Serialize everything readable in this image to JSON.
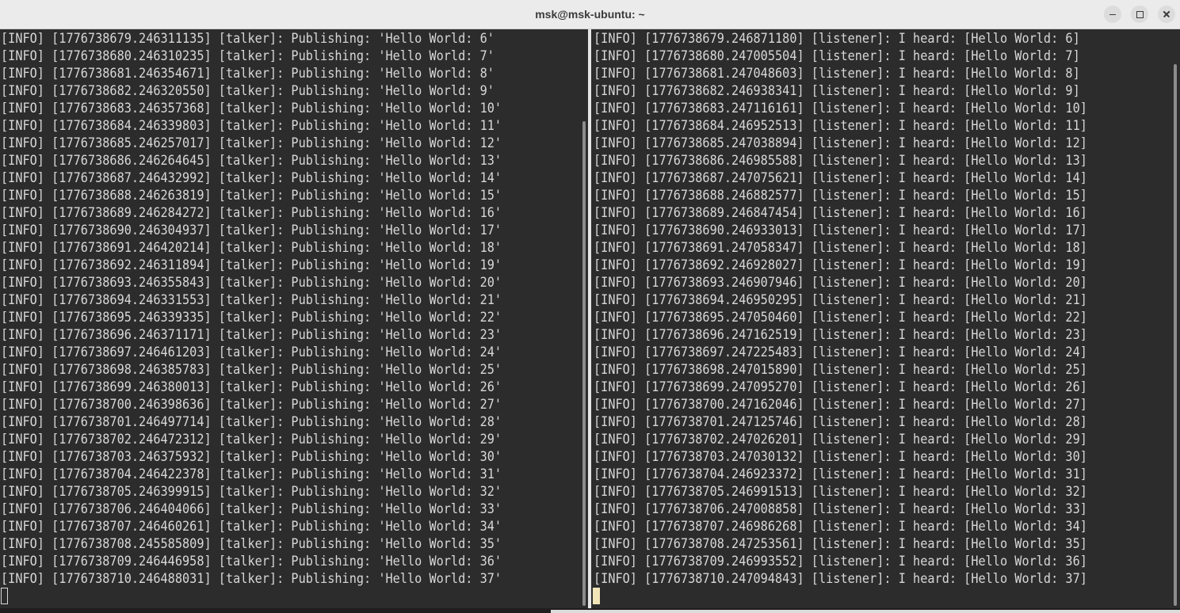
{
  "window": {
    "title": "msk@msk-ubuntu: ~",
    "buttons": {
      "minimize_icon": "minimize-icon",
      "maximize_icon": "maximize-icon",
      "close_icon": "close-icon"
    }
  },
  "colors": {
    "terminal_background": "#2c2c2c",
    "terminal_text": "#d8d8d8",
    "titlebar_background": "#ebebeb",
    "active_cursor": "#f2e6b8"
  },
  "left_pane": {
    "lines": [
      "[INFO] [1776738679.246311135] [talker]: Publishing: 'Hello World: 6'",
      "[INFO] [1776738680.246310235] [talker]: Publishing: 'Hello World: 7'",
      "[INFO] [1776738681.246354671] [talker]: Publishing: 'Hello World: 8'",
      "[INFO] [1776738682.246320550] [talker]: Publishing: 'Hello World: 9'",
      "[INFO] [1776738683.246357368] [talker]: Publishing: 'Hello World: 10'",
      "[INFO] [1776738684.246339803] [talker]: Publishing: 'Hello World: 11'",
      "[INFO] [1776738685.246257017] [talker]: Publishing: 'Hello World: 12'",
      "[INFO] [1776738686.246264645] [talker]: Publishing: 'Hello World: 13'",
      "[INFO] [1776738687.246432992] [talker]: Publishing: 'Hello World: 14'",
      "[INFO] [1776738688.246263819] [talker]: Publishing: 'Hello World: 15'",
      "[INFO] [1776738689.246284272] [talker]: Publishing: 'Hello World: 16'",
      "[INFO] [1776738690.246304937] [talker]: Publishing: 'Hello World: 17'",
      "[INFO] [1776738691.246420214] [talker]: Publishing: 'Hello World: 18'",
      "[INFO] [1776738692.246311894] [talker]: Publishing: 'Hello World: 19'",
      "[INFO] [1776738693.246355843] [talker]: Publishing: 'Hello World: 20'",
      "[INFO] [1776738694.246331553] [talker]: Publishing: 'Hello World: 21'",
      "[INFO] [1776738695.246339335] [talker]: Publishing: 'Hello World: 22'",
      "[INFO] [1776738696.246371171] [talker]: Publishing: 'Hello World: 23'",
      "[INFO] [1776738697.246461203] [talker]: Publishing: 'Hello World: 24'",
      "[INFO] [1776738698.246385783] [talker]: Publishing: 'Hello World: 25'",
      "[INFO] [1776738699.246380013] [talker]: Publishing: 'Hello World: 26'",
      "[INFO] [1776738700.246398636] [talker]: Publishing: 'Hello World: 27'",
      "[INFO] [1776738701.246497714] [talker]: Publishing: 'Hello World: 28'",
      "[INFO] [1776738702.246472312] [talker]: Publishing: 'Hello World: 29'",
      "[INFO] [1776738703.246375932] [talker]: Publishing: 'Hello World: 30'",
      "[INFO] [1776738704.246422378] [talker]: Publishing: 'Hello World: 31'",
      "[INFO] [1776738705.246399915] [talker]: Publishing: 'Hello World: 32'",
      "[INFO] [1776738706.246404066] [talker]: Publishing: 'Hello World: 33'",
      "[INFO] [1776738707.246460261] [talker]: Publishing: 'Hello World: 34'",
      "[INFO] [1776738708.245585809] [talker]: Publishing: 'Hello World: 35'",
      "[INFO] [1776738709.246446958] [talker]: Publishing: 'Hello World: 36'",
      "[INFO] [1776738710.246488031] [talker]: Publishing: 'Hello World: 37'"
    ]
  },
  "right_pane": {
    "lines": [
      "[INFO] [1776738679.246871180] [listener]: I heard: [Hello World: 6]",
      "[INFO] [1776738680.247005504] [listener]: I heard: [Hello World: 7]",
      "[INFO] [1776738681.247048603] [listener]: I heard: [Hello World: 8]",
      "[INFO] [1776738682.246938341] [listener]: I heard: [Hello World: 9]",
      "[INFO] [1776738683.247116161] [listener]: I heard: [Hello World: 10]",
      "[INFO] [1776738684.246952513] [listener]: I heard: [Hello World: 11]",
      "[INFO] [1776738685.247038894] [listener]: I heard: [Hello World: 12]",
      "[INFO] [1776738686.246985588] [listener]: I heard: [Hello World: 13]",
      "[INFO] [1776738687.247075621] [listener]: I heard: [Hello World: 14]",
      "[INFO] [1776738688.246882577] [listener]: I heard: [Hello World: 15]",
      "[INFO] [1776738689.246847454] [listener]: I heard: [Hello World: 16]",
      "[INFO] [1776738690.246933013] [listener]: I heard: [Hello World: 17]",
      "[INFO] [1776738691.247058347] [listener]: I heard: [Hello World: 18]",
      "[INFO] [1776738692.246928027] [listener]: I heard: [Hello World: 19]",
      "[INFO] [1776738693.246907946] [listener]: I heard: [Hello World: 20]",
      "[INFO] [1776738694.246950295] [listener]: I heard: [Hello World: 21]",
      "[INFO] [1776738695.247050460] [listener]: I heard: [Hello World: 22]",
      "[INFO] [1776738696.247162519] [listener]: I heard: [Hello World: 23]",
      "[INFO] [1776738697.247225483] [listener]: I heard: [Hello World: 24]",
      "[INFO] [1776738698.247015890] [listener]: I heard: [Hello World: 25]",
      "[INFO] [1776738699.247095270] [listener]: I heard: [Hello World: 26]",
      "[INFO] [1776738700.247162046] [listener]: I heard: [Hello World: 27]",
      "[INFO] [1776738701.247125746] [listener]: I heard: [Hello World: 28]",
      "[INFO] [1776738702.247026201] [listener]: I heard: [Hello World: 29]",
      "[INFO] [1776738703.247030132] [listener]: I heard: [Hello World: 30]",
      "[INFO] [1776738704.246923372] [listener]: I heard: [Hello World: 31]",
      "[INFO] [1776738705.246991513] [listener]: I heard: [Hello World: 32]",
      "[INFO] [1776738706.247008858] [listener]: I heard: [Hello World: 33]",
      "[INFO] [1776738707.246986268] [listener]: I heard: [Hello World: 34]",
      "[INFO] [1776738708.247253561] [listener]: I heard: [Hello World: 35]",
      "[INFO] [1776738709.246993552] [listener]: I heard: [Hello World: 36]",
      "[INFO] [1776738710.247094843] [listener]: I heard: [Hello World: 37]"
    ]
  }
}
